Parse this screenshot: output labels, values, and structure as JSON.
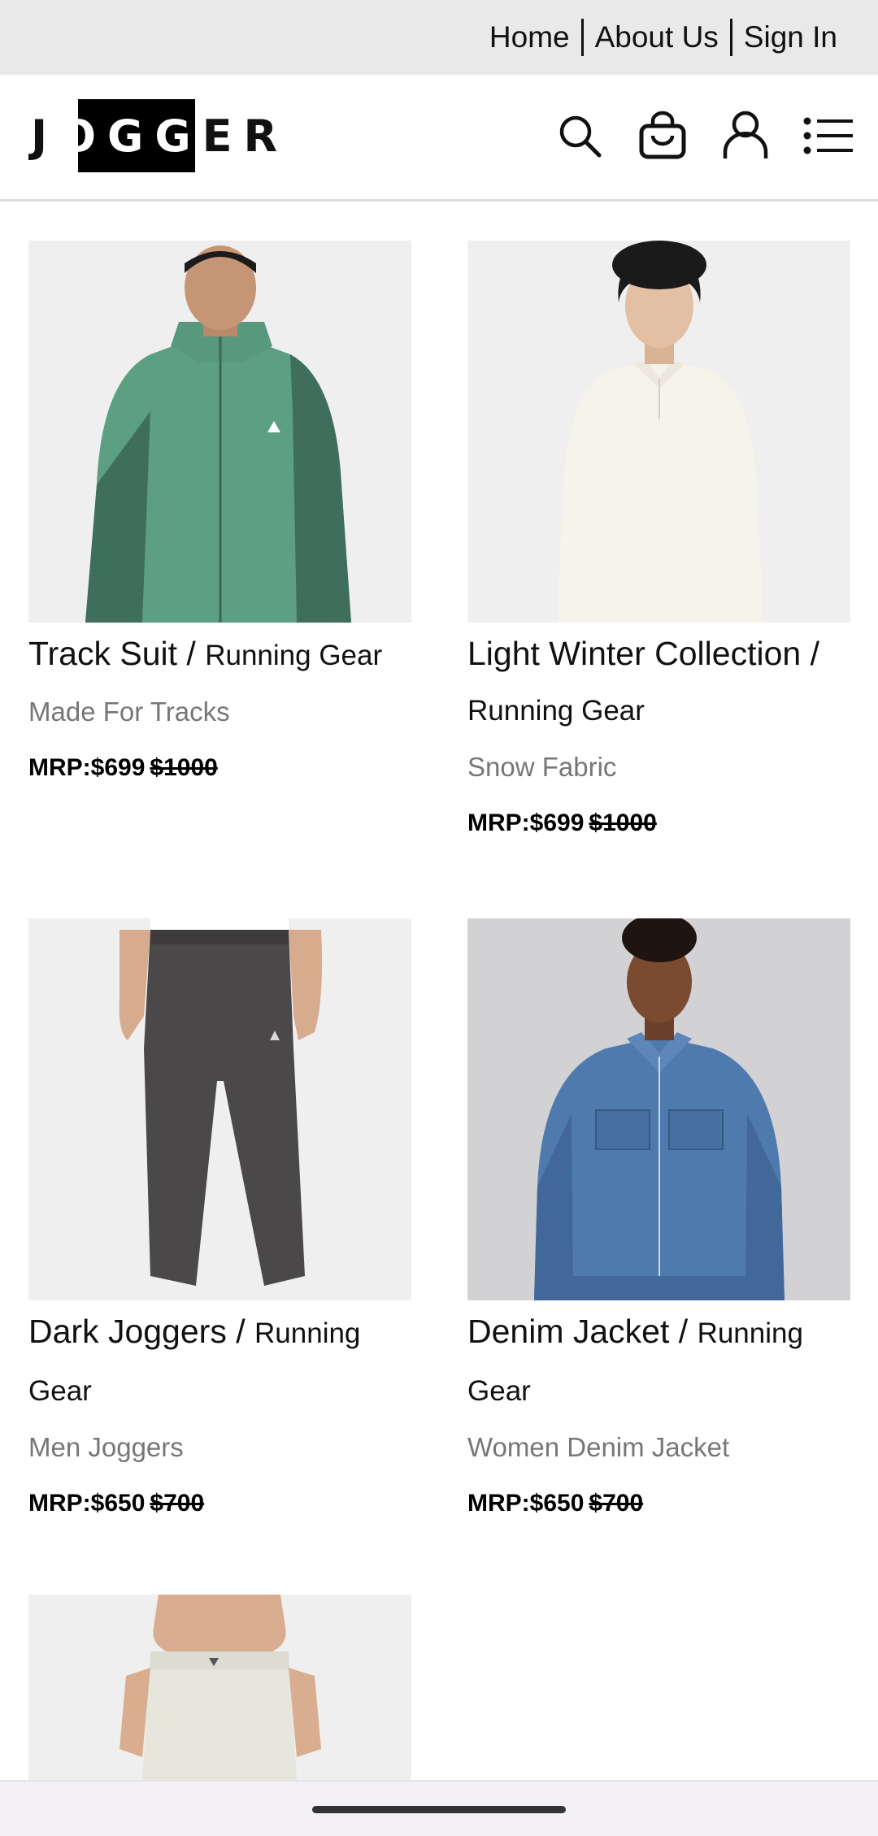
{
  "topnav": {
    "links": [
      "Home",
      "About Us",
      "Sign In"
    ]
  },
  "brand": {
    "logo_text": "JOGGER"
  },
  "header_icons": [
    "search-icon",
    "bag-icon",
    "user-icon",
    "menu-icon"
  ],
  "products": [
    {
      "name": "Track Suit",
      "separator": " / ",
      "category": "Running Gear",
      "subtitle": "Made For Tracks",
      "price_label": "MRP:$699",
      "old_price": "$1000",
      "image": "green-track-jacket"
    },
    {
      "name": "Light Winter Collection",
      "separator": " / ",
      "category": "Running Gear",
      "subtitle": "Snow Fabric",
      "price_label": "MRP:$699",
      "old_price": "$1000",
      "image": "cream-sweatshirt"
    },
    {
      "name": "Dark Joggers",
      "separator": " / ",
      "category": "Running Gear",
      "subtitle": "Men Joggers",
      "price_label": "MRP:$650",
      "old_price": "$700",
      "image": "charcoal-joggers"
    },
    {
      "name": "Denim Jacket",
      "separator": " / ",
      "category": "Running Gear",
      "subtitle": "Women Denim Jacket",
      "price_label": "MRP:$650",
      "old_price": "$700",
      "image": "blue-denim-jacket"
    },
    {
      "image": "white-pants"
    }
  ],
  "colors": {
    "topbar_bg": "#e9e9e9",
    "subtitle_gray": "#777777",
    "image_bg": "#efefef"
  }
}
